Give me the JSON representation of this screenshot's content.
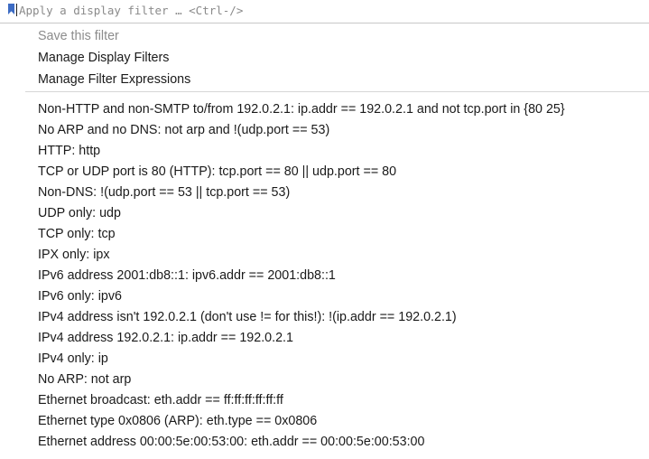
{
  "filter_bar": {
    "placeholder": "Apply a display filter … <Ctrl-/>",
    "bookmark_icon": "bookmark-icon"
  },
  "menu": {
    "actions": [
      {
        "label": "Save this filter",
        "enabled": false
      },
      {
        "label": "Manage Display Filters",
        "enabled": true
      },
      {
        "label": "Manage Filter Expressions",
        "enabled": true
      }
    ],
    "filters": [
      "Non-HTTP and non-SMTP to/from 192.0.2.1: ip.addr == 192.0.2.1 and not tcp.port in {80 25}",
      "No ARP and no DNS: not arp and !(udp.port == 53)",
      "HTTP: http",
      "TCP or UDP port is 80 (HTTP): tcp.port == 80 || udp.port == 80",
      "Non-DNS: !(udp.port == 53 || tcp.port == 53)",
      "UDP only: udp",
      "TCP only: tcp",
      "IPX only: ipx",
      "IPv6 address 2001:db8::1: ipv6.addr == 2001:db8::1",
      "IPv6 only: ipv6",
      "IPv4 address isn't 192.0.2.1 (don't use != for this!): !(ip.addr == 192.0.2.1)",
      "IPv4 address 192.0.2.1: ip.addr == 192.0.2.1",
      "IPv4 only: ip",
      "No ARP: not arp",
      "Ethernet broadcast: eth.addr == ff:ff:ff:ff:ff:ff",
      "Ethernet type 0x0806 (ARP): eth.type == 0x0806",
      "Ethernet address 00:00:5e:00:53:00: eth.addr == 00:00:5e:00:53:00"
    ]
  },
  "colors": {
    "accent": "#3d6cc4",
    "disabled_text": "#8c8c8c"
  }
}
